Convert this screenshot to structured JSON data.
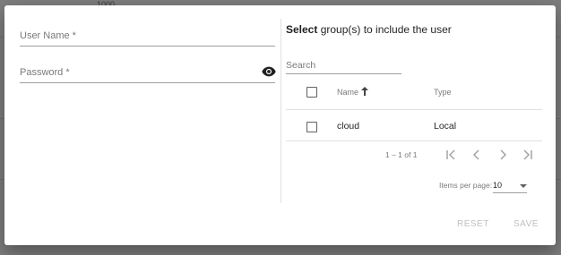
{
  "background": {
    "ghost_text": "1000"
  },
  "form": {
    "username_placeholder": "User Name *",
    "password_placeholder": "Password *"
  },
  "groups": {
    "heading_bold": "Select",
    "heading_rest": " group(s) to include the user",
    "search_placeholder": "Search",
    "columns": {
      "name": "Name",
      "type": "Type"
    },
    "rows": [
      {
        "name": "cloud",
        "type": "Local"
      }
    ],
    "paginator": {
      "range_label": "1 – 1 of 1",
      "items_per_page_label": "Items per page:",
      "page_size": "10"
    }
  },
  "actions": {
    "reset_label": "RESET",
    "save_label": "SAVE"
  },
  "colors": {
    "overlay": "#7d7d7d",
    "dialog": "#ffffff",
    "divider": "#e0e0e0"
  },
  "icons": [
    "visibility-eye-icon",
    "sort-up-arrow-icon",
    "first-page-icon",
    "previous-page-icon",
    "next-page-icon",
    "last-page-icon",
    "dropdown-caret-icon"
  ]
}
